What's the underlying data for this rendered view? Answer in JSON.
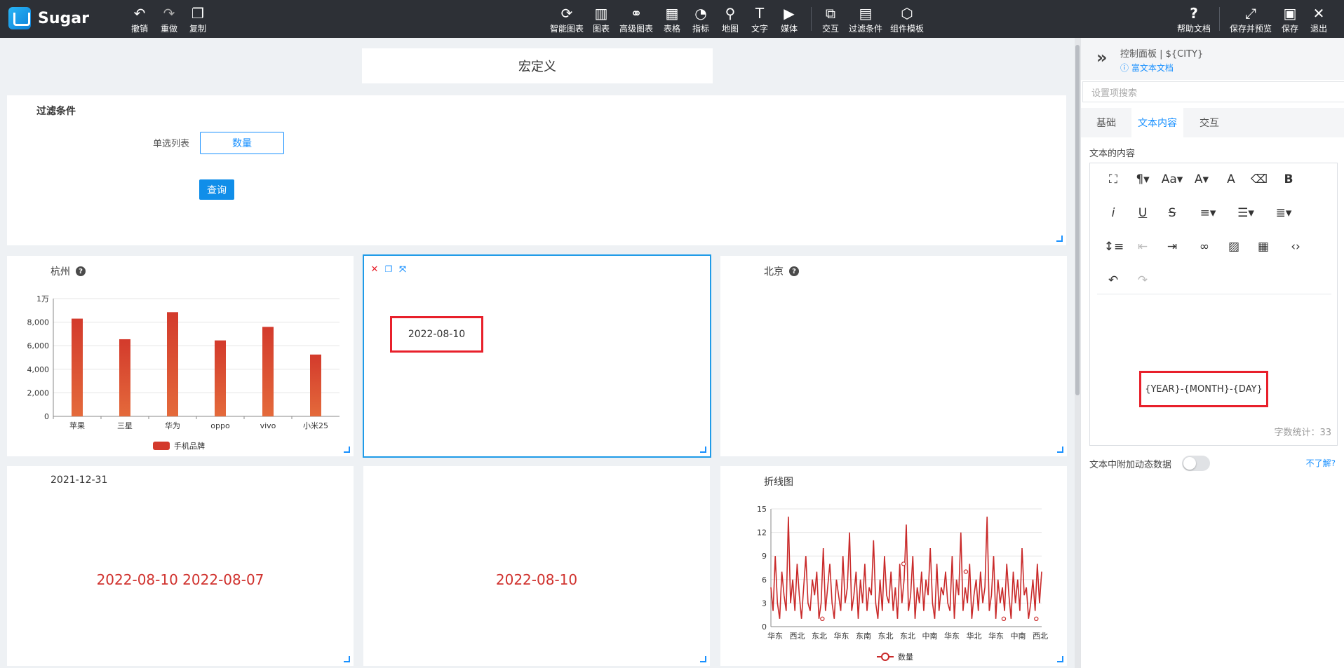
{
  "app": {
    "name": "Sugar"
  },
  "toolbar_left": [
    {
      "icon": "undo-icon",
      "glyph": "↶",
      "label": "撤销"
    },
    {
      "icon": "redo-icon",
      "glyph": "↷",
      "label": "重做"
    },
    {
      "icon": "copy-icon",
      "glyph": "❐",
      "label": "复制"
    }
  ],
  "toolbar_center": [
    {
      "icon": "smart-chart-icon",
      "glyph": "⟳",
      "label": "智能图表"
    },
    {
      "icon": "bar-chart-icon",
      "glyph": "▥",
      "label": "图表"
    },
    {
      "icon": "advanced-chart-icon",
      "glyph": "⚭",
      "label": "高级图表"
    },
    {
      "icon": "table-icon",
      "glyph": "▦",
      "label": "表格"
    },
    {
      "icon": "gauge-icon",
      "glyph": "◔",
      "label": "指标"
    },
    {
      "icon": "map-pin-icon",
      "glyph": "⚲",
      "label": "地图"
    },
    {
      "icon": "text-icon",
      "glyph": "T",
      "label": "文字"
    },
    {
      "icon": "media-icon",
      "glyph": "▶",
      "label": "媒体"
    },
    {
      "icon": "interaction-icon",
      "glyph": "⧉",
      "label": "交互"
    },
    {
      "icon": "filter-icon",
      "glyph": "▤",
      "label": "过滤条件"
    },
    {
      "icon": "template-icon",
      "glyph": "⬡",
      "label": "组件模板"
    }
  ],
  "toolbar_right": [
    {
      "icon": "help-icon",
      "glyph": "?",
      "label": "帮助文档"
    },
    {
      "icon": "save-preview-icon",
      "glyph": "⤢",
      "label": "保存并预览"
    },
    {
      "icon": "save-icon",
      "glyph": "▣",
      "label": "保存"
    },
    {
      "icon": "exit-icon",
      "glyph": "✕",
      "label": "退出"
    }
  ],
  "canvas": {
    "macro_title": "宏定义",
    "filter": {
      "title": "过滤条件",
      "label": "单选列表",
      "value": "数量",
      "query_button": "查询"
    },
    "hangzhou_card": {
      "title": "杭州"
    },
    "selected_text_card": {
      "value": "2022-08-10"
    },
    "beijing_card": {
      "title": "北京"
    },
    "date_card": {
      "title": "2021-12-31",
      "value": "2022-08-10 2022-08-07"
    },
    "date_card2": {
      "value": "2022-08-10"
    },
    "line_card": {
      "title": "折线图"
    }
  },
  "chart_data": [
    {
      "type": "bar",
      "title": "杭州",
      "categories": [
        "苹果",
        "三星",
        "华为",
        "oppo",
        "vivo",
        "小米25"
      ],
      "series": [
        {
          "name": "手机品牌",
          "values": [
            8300,
            6550,
            8850,
            6450,
            7600,
            5250
          ]
        }
      ],
      "ylim": [
        0,
        10000
      ],
      "yticks": [
        "0",
        "2,000",
        "4,000",
        "6,000",
        "8,000",
        "1万"
      ],
      "grid": true,
      "legend": "bottom",
      "color": "#d33a2c"
    },
    {
      "type": "line",
      "title": "折线图",
      "xticks": [
        "华东",
        "西北",
        "东北",
        "华东",
        "东南",
        "东北",
        "东北",
        "中南",
        "华东",
        "华北",
        "华东",
        "中南",
        "西北"
      ],
      "series": [
        {
          "name": "数量",
          "values": [
            5,
            2,
            9,
            3,
            1,
            7,
            4,
            2,
            14,
            3,
            6,
            2,
            8,
            4,
            1,
            5,
            9,
            3,
            2,
            6,
            4,
            7,
            1,
            3,
            10,
            2,
            5,
            8,
            3,
            1,
            6,
            4,
            2,
            9,
            3,
            5,
            12,
            2,
            4,
            7,
            1,
            6,
            3,
            8,
            2,
            5,
            4,
            11,
            3,
            1,
            6,
            2,
            9,
            4,
            3,
            7,
            2,
            5,
            1,
            8,
            3,
            6,
            13,
            2,
            4,
            9,
            1,
            5,
            3,
            7,
            2,
            6,
            4,
            10,
            3,
            1,
            8,
            2,
            5,
            4,
            7,
            3,
            2,
            9,
            1,
            6,
            4,
            12,
            2,
            5,
            3,
            8,
            1,
            4,
            6,
            2,
            7,
            3,
            5,
            14,
            2,
            4,
            9,
            1,
            6,
            3,
            5,
            2,
            8,
            4,
            1,
            7,
            3,
            6,
            2,
            10,
            4,
            5,
            1,
            3,
            6,
            2,
            8,
            3,
            7
          ]
        }
      ],
      "ylim": [
        0,
        15
      ],
      "yticks": [
        "0",
        "3",
        "6",
        "9",
        "12",
        "15"
      ],
      "grid": true,
      "legend": "bottom",
      "color": "#c92a2a"
    }
  ],
  "panel": {
    "title": "控制面板 | ${CITY}",
    "doc_link": "富文本文档",
    "search_placeholder": "设置项搜索",
    "tabs": [
      "基础",
      "文本内容",
      "交互"
    ],
    "section": "文本的内容",
    "editor_text": "{YEAR}-{MONTH}-{DAY}",
    "word_count": "字数统计：33",
    "dynamic_label": "文本中附加动态数据",
    "dynamic_help": "不了解?"
  }
}
